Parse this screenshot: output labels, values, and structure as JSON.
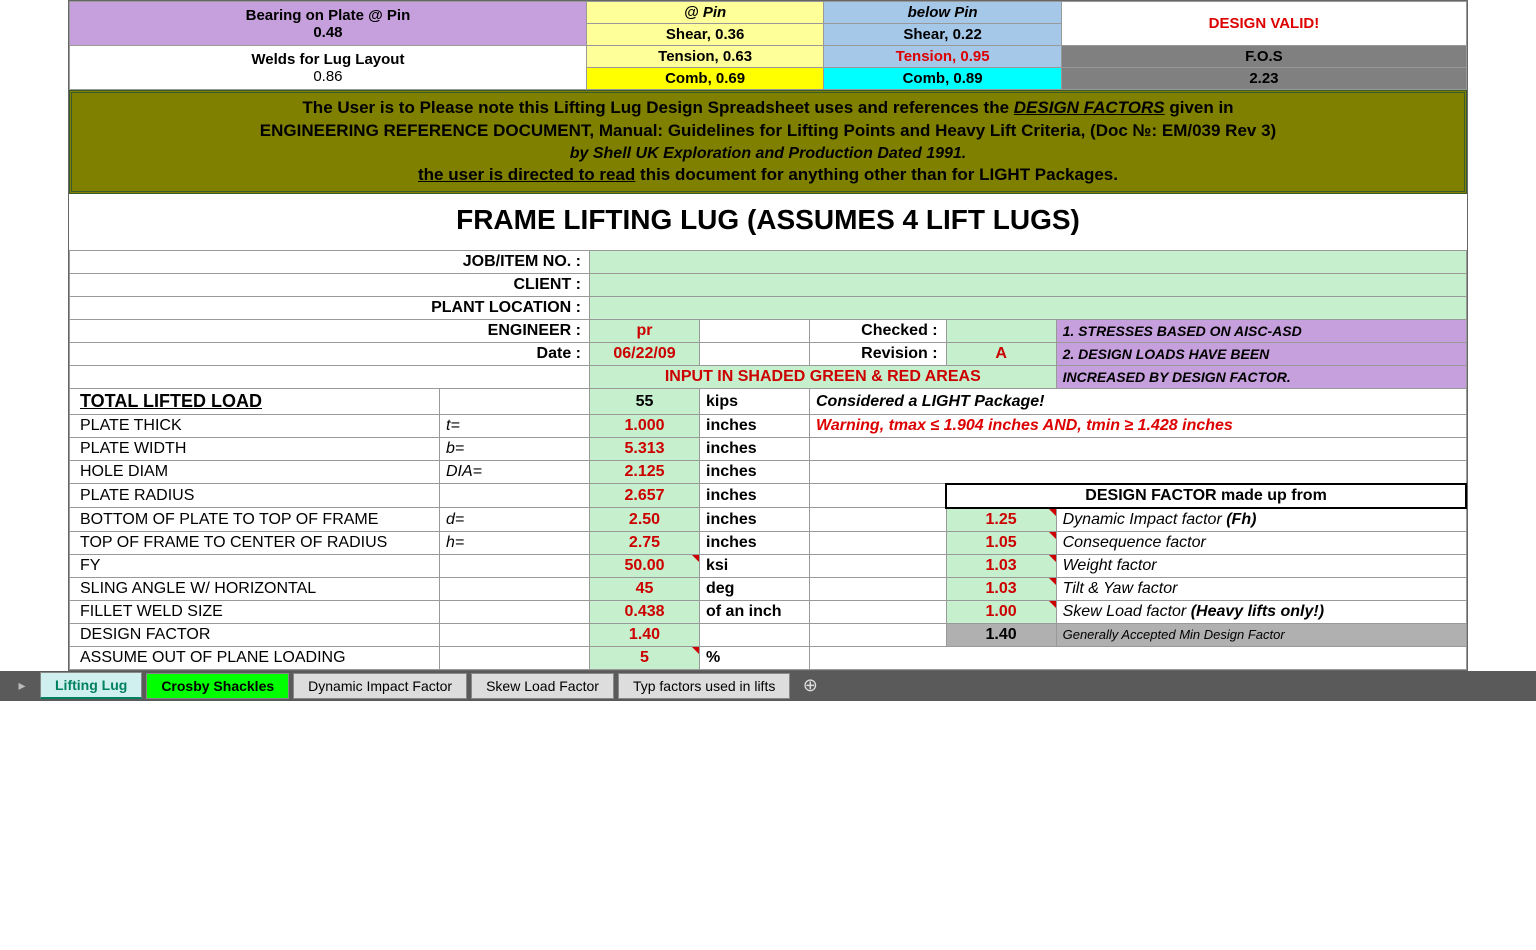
{
  "summary": {
    "r1c1_l1": "Bearing on Plate @ Pin",
    "r1c1_l2": "0.48",
    "r1c2": "@ Pin",
    "r1c3": "below Pin",
    "r1c4": "DESIGN VALID!",
    "r2c2": "Shear, 0.36",
    "r2c3": "Shear, 0.22",
    "r3c1_l1": "Welds for Lug Layout",
    "r3c1_l2": "0.86",
    "r3c2": "Tension, 0.63",
    "r3c3": "Tension, 0.95",
    "r3c4": "F.O.S",
    "r4c2": "Comb, 0.69",
    "r4c3": "Comb, 0.89",
    "r4c4": "2.23"
  },
  "olive": {
    "line1a": "The User is to Please note this Lifting Lug Design Spreadsheet uses and references the ",
    "line1b": "DESIGN FACTORS",
    "line1c": " given in",
    "line2": "ENGINEERING REFERENCE DOCUMENT, Manual: Guidelines for Lifting Points and Heavy Lift Criteria, (Doc №: EM/039 Rev 3)",
    "line3": "by Shell UK Exploration and Production Dated 1991.",
    "line4a": "the user is directed to read",
    "line4b": " this document for anything other than for LIGHT Packages."
  },
  "title": "FRAME LIFTING LUG   (ASSUMES 4 LIFT LUGS)",
  "hdr": {
    "job": "JOB/ITEM NO. :",
    "client": "CLIENT :",
    "plant": "PLANT LOCATION :",
    "eng": "ENGINEER :",
    "eng_v": "pr",
    "checked": "Checked :",
    "date": "Date :",
    "date_v": "06/22/09",
    "rev": "Revision :",
    "rev_v": "A",
    "input": "INPUT IN SHADED GREEN & RED AREAS",
    "note1": "1. STRESSES BASED ON AISC-ASD",
    "note2": "2. DESIGN LOADS HAVE BEEN",
    "note3": "    INCREASED BY DESIGN FACTOR."
  },
  "rows": [
    {
      "lbl": "TOTAL LIFTED LOAD",
      "sym": "",
      "val": "55",
      "unit": "kips",
      "note": "Considered a LIGHT Package!",
      "cls": "tll",
      "vblack": true
    },
    {
      "lbl": "PLATE THICK",
      "sym": "t=",
      "val": "1.000",
      "unit": "inches",
      "note": "Warning, tmax ≤ 1.904 inches AND, tmin ≥ 1.428 inches",
      "warn": true
    },
    {
      "lbl": "PLATE WIDTH",
      "sym": "b=",
      "val": "5.313",
      "unit": "inches"
    },
    {
      "lbl": "HOLE DIAM",
      "sym": "DIA=",
      "val": "2.125",
      "unit": "inches"
    },
    {
      "lbl": "PLATE RADIUS",
      "sym": "",
      "val": "2.657",
      "unit": "inches"
    },
    {
      "lbl": "BOTTOM OF PLATE TO TOP OF FRAME",
      "sym": "d=",
      "val": "2.50",
      "unit": "inches"
    },
    {
      "lbl": "TOP OF FRAME TO CENTER OF RADIUS",
      "sym": "h=",
      "val": "2.75",
      "unit": "inches"
    },
    {
      "lbl": "FY",
      "sym": "",
      "val": "50.00",
      "unit": "ksi",
      "tri": true
    },
    {
      "lbl": "SLING ANGLE W/ HORIZONTAL",
      "sym": "",
      "val": "45",
      "unit": "deg"
    },
    {
      "lbl": "FILLET WELD SIZE",
      "sym": "",
      "val": "0.438",
      "unit": "of an inch"
    },
    {
      "lbl": "DESIGN FACTOR",
      "sym": "",
      "val": "1.40",
      "unit": ""
    },
    {
      "lbl": "ASSUME OUT OF PLANE LOADING",
      "sym": "",
      "val": "5",
      "unit": "%",
      "tri": true
    }
  ],
  "df": {
    "hdr": "DESIGN FACTOR made up from",
    "items": [
      {
        "v": "1.25",
        "l": "Dynamic Impact factor",
        "b": "(Fh)"
      },
      {
        "v": "1.05",
        "l": "Consequence factor"
      },
      {
        "v": "1.03",
        "l": "Weight factor"
      },
      {
        "v": "1.03",
        "l": "Tilt & Yaw factor"
      },
      {
        "v": "1.00",
        "l": "Skew Load factor",
        "b": "(Heavy lifts only!)"
      }
    ],
    "min_v": "1.40",
    "min_l": "Generally Accepted Min Design Factor"
  },
  "tabs": [
    "Lifting Lug",
    "Crosby Shackles",
    "Dynamic Impact Factor",
    "Skew Load Factor",
    "Typ factors used in lifts"
  ]
}
